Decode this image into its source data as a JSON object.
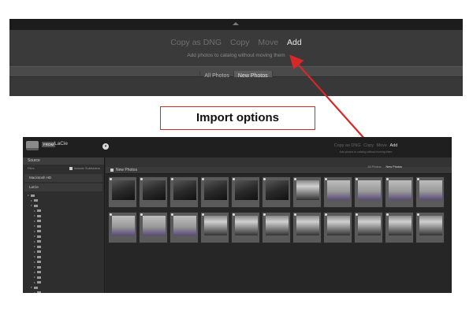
{
  "top": {
    "modes": [
      {
        "label": "Copy as DNG",
        "active": false
      },
      {
        "label": "Copy",
        "active": false
      },
      {
        "label": "Move",
        "active": false
      },
      {
        "label": "Add",
        "active": true
      }
    ],
    "description": "Add photos to catalog without moving them",
    "tabs": [
      {
        "label": "All Photos",
        "selected": false
      },
      {
        "label": "New Photos",
        "selected": true
      }
    ]
  },
  "annotation": {
    "label": "Import options",
    "color": "#d62828"
  },
  "app": {
    "header": {
      "from_badge": "FROM",
      "source_name": "LaCie"
    },
    "sidebar": {
      "section_title": "Source",
      "files_label": "Files",
      "include_subfolders": "Include Subfolders",
      "volumes": [
        "Macintosh HD",
        "LaCie"
      ]
    },
    "tabs": [
      "All Photos",
      "New Photos"
    ],
    "grid_title": "New Photos"
  }
}
